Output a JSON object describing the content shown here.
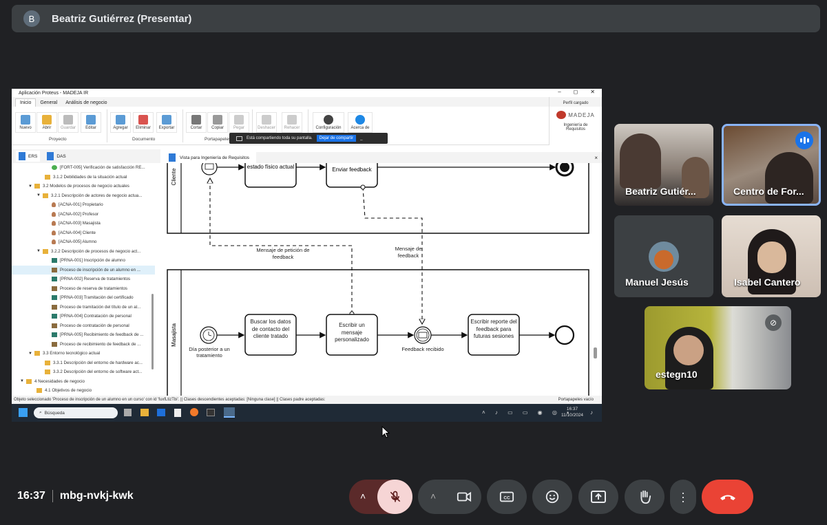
{
  "meet": {
    "presenter_initial": "B",
    "presenter_title": "Beatriz Gutiérrez (Presentar)",
    "time": "16:37",
    "meeting_code": "mbg-nvkj-kwk",
    "participants": [
      {
        "name": "Beatriz Gutiér..."
      },
      {
        "name": "Centro de For..."
      },
      {
        "name": "Manuel Jesús"
      },
      {
        "name": "Isabel Cantero"
      },
      {
        "name": "estegn10"
      }
    ],
    "controls": {
      "mic": "mic-off-icon",
      "camera": "videocam-icon",
      "captions": "captions-icon",
      "emoji": "emoji-icon",
      "present": "present-icon",
      "hand": "raise-hand-icon",
      "more": "more-options-icon",
      "end": "end-call-icon"
    },
    "colors": {
      "bg": "#202124",
      "muted": "#f6d5d5",
      "end": "#ea4335"
    }
  },
  "app": {
    "title": "Aplicación Proteus - MADEJA IR",
    "window_buttons": [
      "–",
      "◻",
      "✕"
    ],
    "tabs": [
      "Inicio",
      "General",
      "Análisis de negocio"
    ],
    "ribbon": {
      "buttons": [
        {
          "label": "Nuevo"
        },
        {
          "label": "Abrir"
        },
        {
          "label": "Guardar"
        },
        {
          "label": "Editar"
        },
        {
          "label": "Agregar"
        },
        {
          "label": "Eliminar"
        },
        {
          "label": "Exportar"
        },
        {
          "label": "Cortar"
        },
        {
          "label": "Copiar"
        },
        {
          "label": "Pegar"
        },
        {
          "label": "Deshacer"
        },
        {
          "label": "Rehacer"
        },
        {
          "label": "Configuración"
        },
        {
          "label": "Acerca de"
        }
      ],
      "groups": [
        "Proyecto",
        "Documento",
        "Portapapeles"
      ]
    },
    "profile": {
      "label": "Perfil cargado",
      "brand": "MADEJA",
      "name": "Ingeniería de Requisitos"
    },
    "share_banner": {
      "text": "Está compartiendo toda su pantalla.",
      "stop": "Dejar de compartir",
      "min": "_"
    },
    "pane_tabs": [
      "ERS",
      "DAS"
    ],
    "tree": [
      {
        "text": "[FORT-005] Verificación de satisfacción RE..."
      },
      {
        "text": "3.1.2 Debilidades de la situación actual"
      },
      {
        "text": "3.2 Modelos de procesos de negocio actuales"
      },
      {
        "text": "3.2.1 Descripción de actores de negocio actua..."
      },
      {
        "text": "[ACNA-001] Propietario"
      },
      {
        "text": "[ACNA-002] Profesor"
      },
      {
        "text": "[ACNA-003] Masajista"
      },
      {
        "text": "[ACNA-004] Cliente"
      },
      {
        "text": "[ACNA-005] Alumno"
      },
      {
        "text": "3.2.2 Descripción de procesos de negocio act..."
      },
      {
        "text": "[PRNA-001] Inscripción de alumno"
      },
      {
        "text": "Proceso de inscripción de un alumno en ..."
      },
      {
        "text": "[PRNA-002] Reserva de tratamientos"
      },
      {
        "text": "Proceso de reserva de tratamientos"
      },
      {
        "text": "[PRNA-003] Tramitación del certificado"
      },
      {
        "text": "Proceso de tramitación del título de un al..."
      },
      {
        "text": "[PRNA-004] Contratación de personal"
      },
      {
        "text": "Proceso de contratación de personal"
      },
      {
        "text": "[PRNA-005] Recibimiento de feedback de ..."
      },
      {
        "text": "Proceso de recibimiento de feedback de ..."
      },
      {
        "text": "3.3 Entorno tecnológico actual"
      },
      {
        "text": "3.3.1 Descripción del entorno de hardware ac..."
      },
      {
        "text": "3.3.2 Descripción del entorno de software act..."
      },
      {
        "text": "4 Necesidades de negocio"
      },
      {
        "text": "4.1 Objetivos de negocio"
      }
    ],
    "view_tab": "Vista para Ingeniería de Requisitos",
    "view_close": "×",
    "diagram": {
      "lane_top": "Cliente",
      "lane_bottom": "Masajista",
      "task_state": "estado físico actual",
      "task_send": "Enviar feedback",
      "task_search": "Buscar los datos de contacto del cliente tratado",
      "task_write": "Escribir un mensaje personalizado",
      "task_report": "Escribir reporte del feedback para futuras sesiones",
      "msg_request": "Mensaje de petición de feedback",
      "msg_feedback": "Mensaje de feedback",
      "timer_label": "Día posterior a un tratamiento",
      "received_label": "Feedback recibido"
    },
    "status": "Objeto seleccionado 'Proceso de inscripción de un alumno en un curso' con id 'fuxfLtizTbi'. || Clases descendientes aceptadas: [Ninguna clase] || Clases padre aceptadas:",
    "clipboard_status": "Portapapeles vacío",
    "taskbar": {
      "search": "Búsqueda",
      "time": "16:37",
      "date": "11/10/2024"
    }
  }
}
